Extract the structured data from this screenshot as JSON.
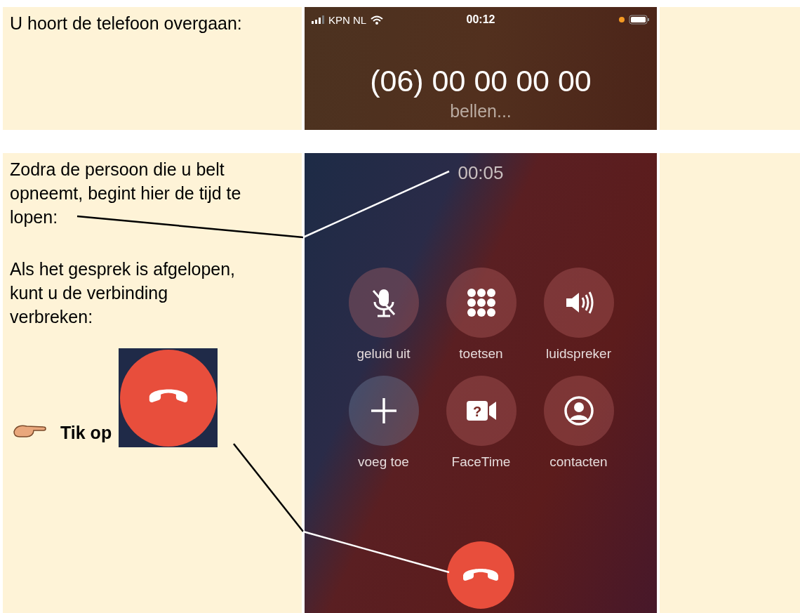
{
  "steps": [
    {
      "kind": "calling",
      "instruction": {
        "lines": [
          "U hoort de telefoon overgaan:"
        ]
      },
      "phone": {
        "status_bar": {
          "carrier": "KPN NL",
          "time": "00:12"
        },
        "number": "(06) 00 00 00 00",
        "status": "bellen..."
      }
    },
    {
      "kind": "in_call",
      "instructions": [
        {
          "lines": [
            "Zodra de persoon die u belt",
            "opneemt, begint hier de tijd te",
            "lopen:"
          ]
        },
        {
          "lines": [
            "Als het gesprek is afgelopen,",
            "kunt u de verbinding",
            "verbreken:"
          ]
        }
      ],
      "tap": {
        "label": "Tik op"
      },
      "phone": {
        "timer": "00:05",
        "buttons": [
          {
            "kind": "mute",
            "label": "geluid uit"
          },
          {
            "kind": "keypad",
            "label": "toetsen"
          },
          {
            "kind": "speaker",
            "label": "luidspreker"
          },
          {
            "kind": "add",
            "label": "voeg toe"
          },
          {
            "kind": "facetime",
            "label": "FaceTime",
            "icon_text": "?"
          },
          {
            "kind": "contacts",
            "label": "contacten"
          }
        ]
      }
    }
  ]
}
